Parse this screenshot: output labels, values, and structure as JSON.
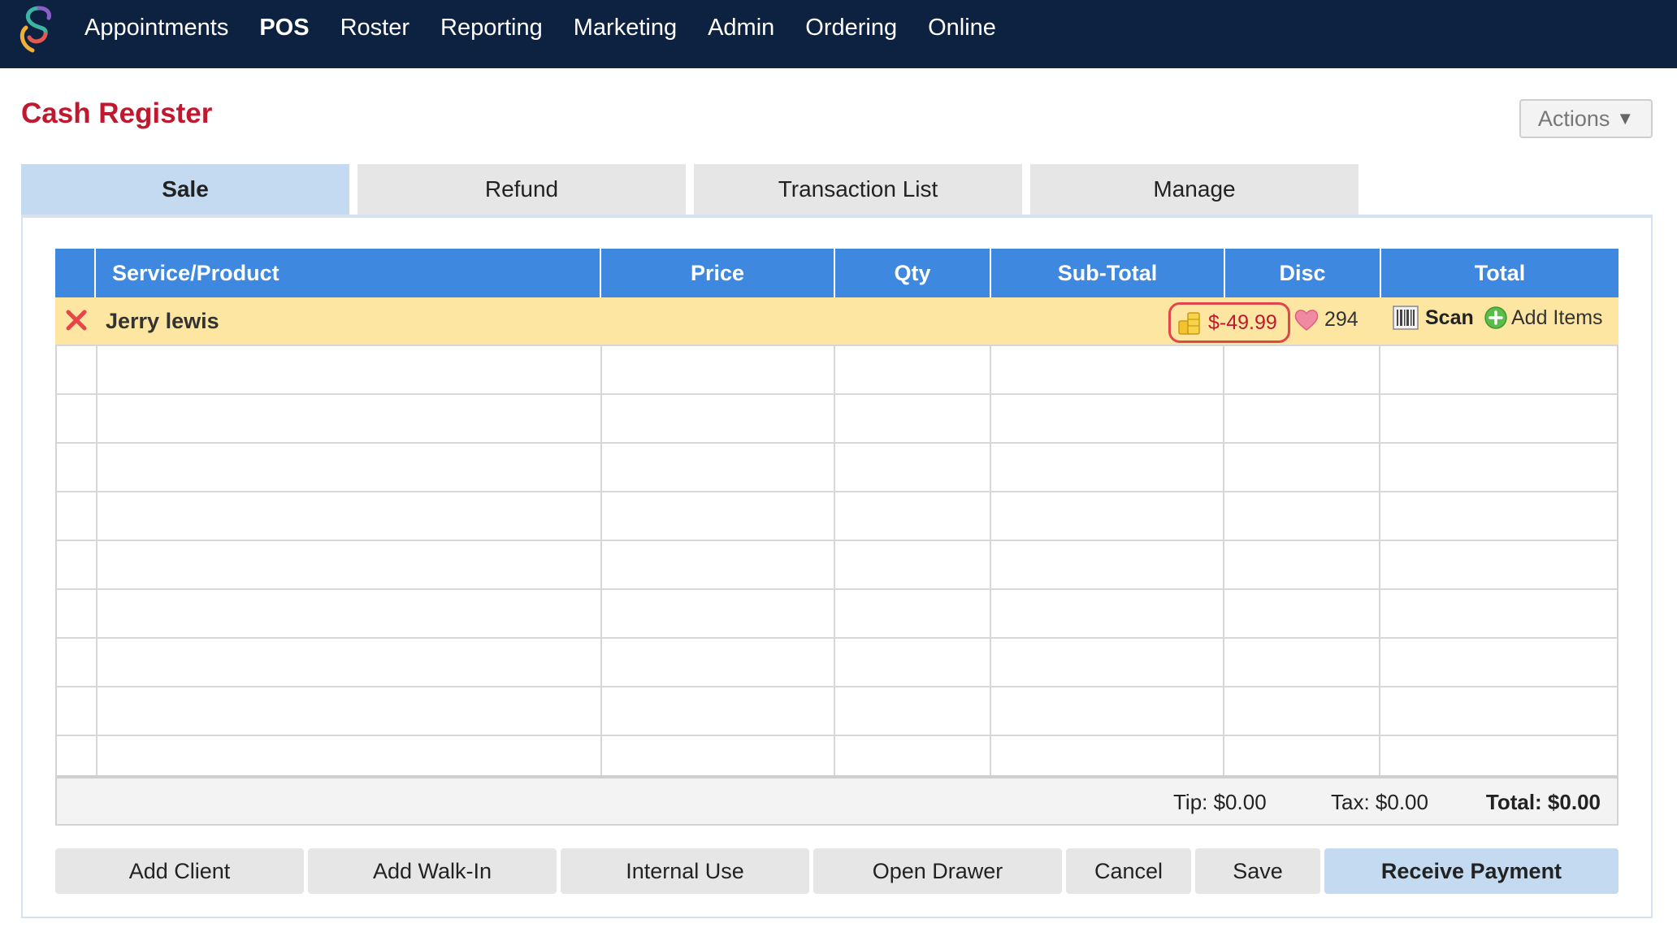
{
  "nav": {
    "items": [
      {
        "label": "Appointments",
        "active": false
      },
      {
        "label": "POS",
        "active": true
      },
      {
        "label": "Roster",
        "active": false
      },
      {
        "label": "Reporting",
        "active": false
      },
      {
        "label": "Marketing",
        "active": false
      },
      {
        "label": "Admin",
        "active": false
      },
      {
        "label": "Ordering",
        "active": false
      },
      {
        "label": "Online",
        "active": false
      }
    ]
  },
  "page": {
    "title": "Cash Register",
    "actions_label": "Actions",
    "actions_arrow": "▼"
  },
  "tabs": [
    {
      "label": "Sale",
      "active": true
    },
    {
      "label": "Refund",
      "active": false
    },
    {
      "label": "Transaction List",
      "active": false
    },
    {
      "label": "Manage",
      "active": false
    }
  ],
  "table": {
    "columns": [
      "",
      "Service/Product",
      "Price",
      "Qty",
      "Sub-Total",
      "Disc",
      "Total"
    ],
    "client": {
      "name": "Jerry lewis",
      "balance": "$-49.99",
      "points": "294",
      "scan_label": "Scan",
      "add_items_label": "Add Items"
    },
    "empty_rows": 9
  },
  "totals": {
    "tip": "Tip: $0.00",
    "tax": "Tax: $0.00",
    "total": "Total: $0.00"
  },
  "buttons": {
    "add_client": "Add Client",
    "add_walk_in": "Add Walk-In",
    "internal_use": "Internal Use",
    "open_drawer": "Open Drawer",
    "cancel": "Cancel",
    "save": "Save",
    "receive_payment": "Receive Payment"
  },
  "colors": {
    "nav_bg": "#0d2240",
    "title": "#c0182e",
    "header_blue": "#3e88e0",
    "client_row": "#fde6a1",
    "active_tab": "#c3daf0"
  }
}
